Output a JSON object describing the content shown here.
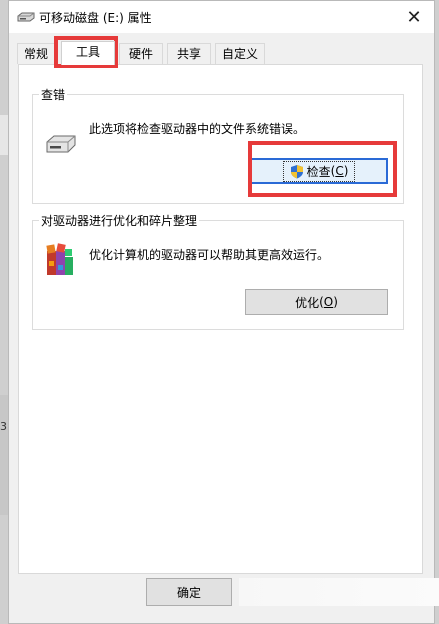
{
  "window": {
    "title": "可移动磁盘 (E:) 属性",
    "close_glyph": "✕"
  },
  "tabs": [
    {
      "label": "常规"
    },
    {
      "label": "工具"
    },
    {
      "label": "硬件"
    },
    {
      "label": "共享"
    },
    {
      "label": "自定义"
    }
  ],
  "active_tab": "工具",
  "check_group": {
    "title": "查错",
    "description": "此选项将检查驱动器中的文件系统错误。",
    "button_label": "检查",
    "button_key": "C"
  },
  "optimize_group": {
    "title": "对驱动器进行优化和碎片整理",
    "description": "优化计算机的驱动器可以帮助其更高效运行。",
    "button_label": "优化",
    "button_key": "O"
  },
  "footer": {
    "ok_label": "确定"
  },
  "background": {
    "left_edge_text": "3"
  },
  "colors": {
    "highlight": "#e63a3a",
    "focus_border": "#2a6ad6"
  }
}
